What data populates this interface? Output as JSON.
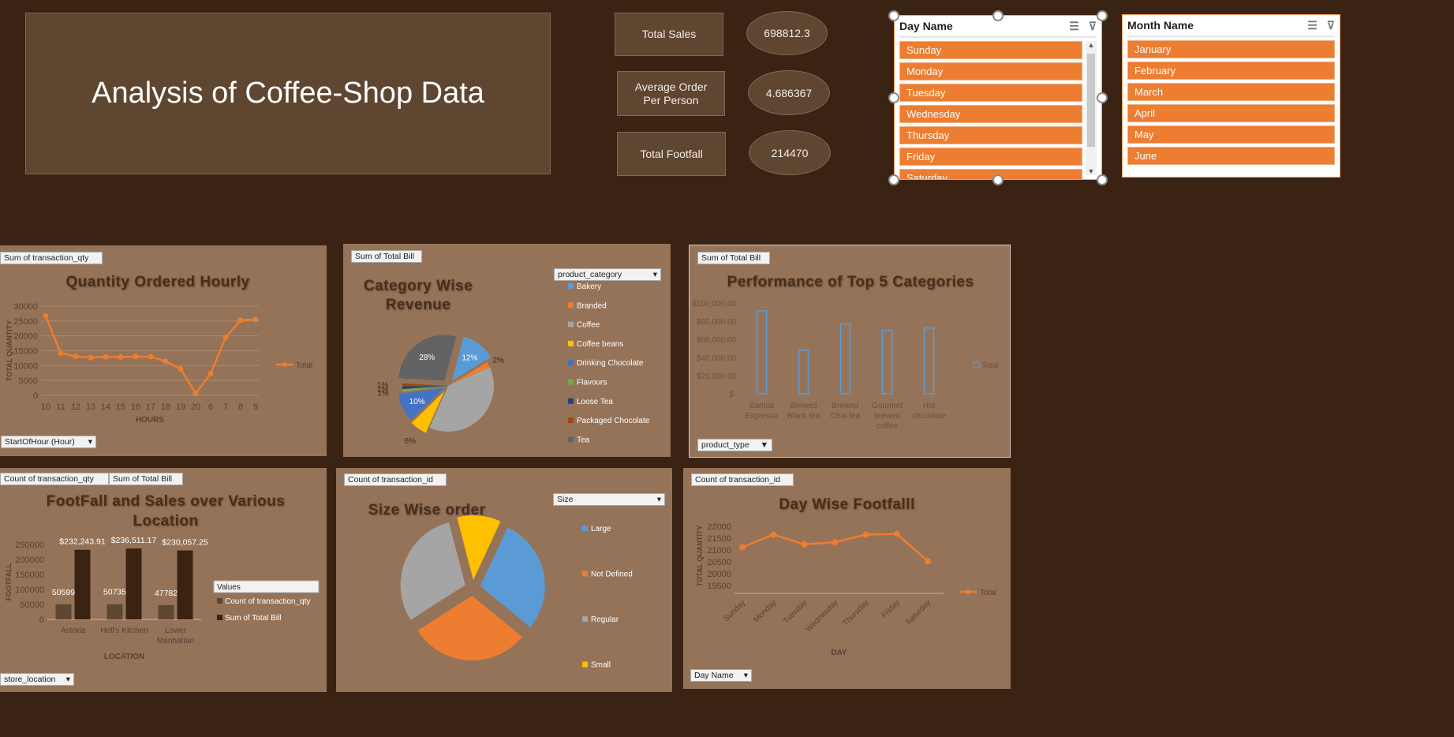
{
  "dashboard": {
    "title": "Analysis of Coffee-Shop Data"
  },
  "kpis": [
    {
      "label": "Total Sales",
      "value": "698812.3"
    },
    {
      "label": "Average Order Per Person",
      "value": "4.686367"
    },
    {
      "label": "Total Footfall",
      "value": "214470"
    }
  ],
  "slicers": {
    "day": {
      "title": "Day Name",
      "items": [
        "Sunday",
        "Monday",
        "Tuesday",
        "Wednesday",
        "Thursday",
        "Friday",
        "Saturday"
      ]
    },
    "month": {
      "title": "Month Name",
      "items": [
        "January",
        "February",
        "March",
        "April",
        "May",
        "June"
      ]
    }
  },
  "colors": {
    "background": "#3b2314",
    "panel": "#957359",
    "accent": "#ed7d31",
    "title_box": "#5f4631",
    "bar_dark": "#3b2314",
    "bar_light": "#5f4631",
    "bar_outline": "#5b9bd5"
  },
  "chart_data": [
    {
      "id": "quantity-hourly",
      "type": "line",
      "field_button": "Sum of transaction_qty",
      "filter_button": "StartOfHour (Hour)",
      "title": "Quantity Ordered Hourly",
      "xlabel": "HOURS",
      "ylabel": "TOTAL QUANTITY",
      "ylim": [
        0,
        30000
      ],
      "yticks": [
        "30000",
        "25000",
        "20000",
        "15000",
        "10000",
        "5000",
        "0"
      ],
      "categories": [
        "10",
        "11",
        "12",
        "13",
        "14",
        "15",
        "16",
        "17",
        "18",
        "19",
        "20",
        "6",
        "7",
        "8",
        "9"
      ],
      "series": [
        {
          "name": "Total",
          "values": [
            26713,
            14221,
            13100,
            12700,
            12950,
            12900,
            13050,
            13000,
            11450,
            8900,
            630,
            7300,
            19500,
            25300,
            25500
          ]
        }
      ],
      "legend": "right",
      "grid": true
    },
    {
      "id": "category-revenue",
      "type": "pie",
      "field_button": "Sum of Total Bill",
      "filter_button": "product_category",
      "title": "Category Wise Revenue",
      "categories": [
        "Bakery",
        "Branded",
        "Coffee",
        "Coffee beans",
        "Drinking Chocolate",
        "Flavours",
        "Loose Tea",
        "Packaged Chocolate",
        "Tea"
      ],
      "values": [
        12,
        2,
        38,
        6,
        10,
        1,
        1,
        1,
        28
      ],
      "data_labels": [
        "12%",
        "2%",
        "",
        "6%",
        "10%",
        "1%",
        "1%",
        "1%",
        "28%"
      ],
      "legend_colors": [
        "#5b9bd5",
        "#ed7d31",
        "#a5a5a5",
        "#ffc000",
        "#4472c4",
        "#70ad47",
        "#264478",
        "#9e480e",
        "#636363"
      ]
    },
    {
      "id": "top5-categories",
      "type": "bar",
      "field_button": "Sum of Total Bill",
      "filter_button": "product_type",
      "title": "Performance of Top 5 Categories",
      "ylim": [
        0,
        100000
      ],
      "yticks": [
        "$100,000.00",
        "$80,000.00",
        "$60,000.00",
        "$40,000.00",
        "$20,000.00",
        "$-"
      ],
      "categories": [
        [
          "Barista",
          "Espresso"
        ],
        [
          "Brewed",
          "Black tea"
        ],
        [
          "Brewed",
          "Chai tea"
        ],
        [
          "Gourmet",
          "brewed",
          "coffee"
        ],
        [
          "Hot",
          "chocolate"
        ]
      ],
      "series": [
        {
          "name": "Total",
          "values": [
            91400,
            47900,
            77100,
            70000,
            72400
          ]
        }
      ],
      "legend": "right"
    },
    {
      "id": "footfall-location",
      "type": "bar",
      "field_buttons": [
        "Count of transaction_qty",
        "Sum of Total Bill"
      ],
      "filter_button": "store_location",
      "title": "FootFall and Sales over Various Location",
      "xlabel": "LOCATION",
      "ylabel": "FOOTFALL",
      "ylim": [
        0,
        250000
      ],
      "yticks": [
        "250000",
        "200000",
        "150000",
        "100000",
        "50000",
        "0"
      ],
      "categories": [
        [
          "Astoria"
        ],
        [
          "Hell's Kitchen"
        ],
        [
          "Lower",
          "Manhattan"
        ]
      ],
      "legend_title": "Values",
      "series": [
        {
          "name": "Count of transaction_qty",
          "values": [
            50599,
            50735,
            47782
          ],
          "labels": [
            "50599",
            "50735",
            "47782"
          ]
        },
        {
          "name": "Sum of Total Bill",
          "values": [
            232243.91,
            236511.17,
            230057.25
          ],
          "labels": [
            "$232,243.91",
            "$236,511.17",
            "$230,057.25"
          ]
        }
      ]
    },
    {
      "id": "size-wise",
      "type": "pie",
      "field_button": "Count of transaction_id",
      "filter_button": "Size",
      "title": "Size Wise order",
      "categories": [
        "Large",
        "Not Defined",
        "Regular",
        "Small"
      ],
      "values": [
        29,
        30,
        30,
        11
      ],
      "legend_colors": [
        "#5b9bd5",
        "#ed7d31",
        "#a5a5a5",
        "#ffc000"
      ]
    },
    {
      "id": "day-footfall",
      "type": "line",
      "field_button": "Count of transaction_id",
      "filter_button": "Day Name",
      "title": "Day Wise Footfalll",
      "xlabel": "DAY",
      "ylabel": "TOTAL QUANTITY",
      "ylim": [
        19500,
        22000
      ],
      "yticks": [
        "22000",
        "21500",
        "21000",
        "20500",
        "20000",
        "19500"
      ],
      "categories": [
        "Sunday",
        "Monday",
        "Tuesday",
        "Wednesday",
        "Thursday",
        "Friday",
        "Saturday"
      ],
      "series": [
        {
          "name": "Total",
          "values": [
            21120,
            21650,
            21240,
            21330,
            21650,
            21680,
            20530
          ]
        }
      ],
      "legend": "right"
    }
  ]
}
